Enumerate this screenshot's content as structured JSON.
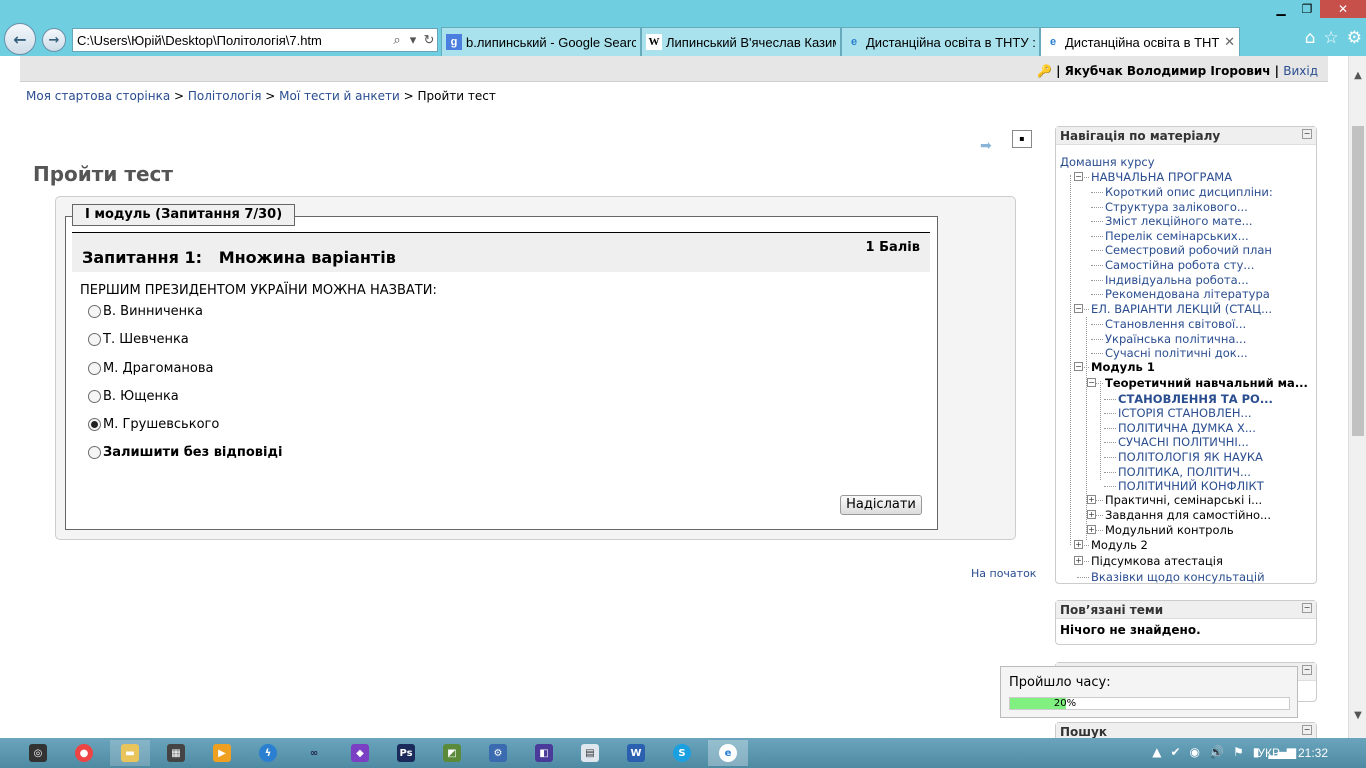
{
  "browser": {
    "address": "C:\\Users\\Юрій\\Desktop\\Політологія\\7.htm",
    "tabs": [
      {
        "label": "b.липинський - Google Search",
        "icon": "google-icon"
      },
      {
        "label": "Липинський В'ячеслав Казим...",
        "icon": "wikipedia-icon"
      },
      {
        "label": "Дистанційна освіта в ТНТУ : ...",
        "icon": "ie-icon"
      },
      {
        "label": "Дистанційна освіта в ТНТУ...",
        "icon": "ie-icon",
        "close": "✕"
      }
    ]
  },
  "user": {
    "name": "Якубчак Володимир Ігорович",
    "sep": "|",
    "logout": "Вихід"
  },
  "breadcrumb": [
    {
      "label": "Моя стартова сторінка"
    },
    {
      "label": "Політологія"
    },
    {
      "label": "Мої тести й анкети"
    },
    {
      "label": "Пройти тест"
    }
  ],
  "page_title": "Пройти тест",
  "quiz": {
    "legend": "I модуль (Запитання 7/30)",
    "question_title": "Запитання 1:   Множина варіантів",
    "marks": "1 Балів",
    "question_text": "ПЕРШИМ ПРЕЗИДЕНТОМ УКРАЇНИ МОЖНА НАЗВАТИ:",
    "options": [
      {
        "label": "В. Винниченка",
        "selected": false
      },
      {
        "label": "Т. Шевченка",
        "selected": false
      },
      {
        "label": "М. Драгоманова",
        "selected": false
      },
      {
        "label": "В. Ющенка",
        "selected": false
      },
      {
        "label": "М. Грушевського",
        "selected": true
      },
      {
        "label": "Залишити без відповіді",
        "selected": false
      }
    ],
    "submit": "Надіслати",
    "to_top": "На початок"
  },
  "nav_block": {
    "title": "Навігація по матеріалу",
    "items": [
      {
        "label": "Домашня курсу"
      },
      {
        "label": "НАВЧАЛЬНА ПРОГРАМА"
      },
      {
        "label": "Короткий опис дисципліни:"
      },
      {
        "label": "Структура залікового..."
      },
      {
        "label": "Зміст лекційного мате..."
      },
      {
        "label": "Перелік семінарських..."
      },
      {
        "label": "Семестровий робочий план"
      },
      {
        "label": "Самостійна робота сту..."
      },
      {
        "label": "Індивідуальна робота..."
      },
      {
        "label": "Рекомендована література"
      },
      {
        "label": "ЕЛ. ВАРІАНТИ ЛЕКЦІЙ (СТАЦ..."
      },
      {
        "label": "Становлення світової..."
      },
      {
        "label": "Українська політична..."
      },
      {
        "label": "Сучасні політичні док..."
      },
      {
        "label": "Модуль 1"
      },
      {
        "label": "Теоретичний навчальний ма..."
      },
      {
        "label": "СТАНОВЛЕННЯ ТА РО..."
      },
      {
        "label": "ІСТОРІЯ СТАНОВЛЕН..."
      },
      {
        "label": "ПОЛІТИЧНА ДУМКА Х..."
      },
      {
        "label": "СУЧАСНІ ПОЛІТИЧНІ..."
      },
      {
        "label": "ПОЛІТОЛОГІЯ ЯК НАУКА"
      },
      {
        "label": "ПОЛІТИКА, ПОЛІТИЧ..."
      },
      {
        "label": "ПОЛІТИЧНИЙ КОНФЛІКТ"
      },
      {
        "label": "Практичні, семінарські і..."
      },
      {
        "label": "Завдання для самостійно..."
      },
      {
        "label": "Модульний контроль"
      },
      {
        "label": "Модуль 2"
      },
      {
        "label": "Підсумкова атестація"
      },
      {
        "label": "Вказівки щодо консультацій"
      }
    ]
  },
  "related_block": {
    "title": "Пов’язані теми",
    "empty": "Нічого не знайдено."
  },
  "search_block": {
    "title": "Пошук"
  },
  "timer": {
    "label": "Пройшло часу:",
    "progress": 0.2,
    "progress_text": "20%"
  },
  "taskbar": {
    "lang": "УКР",
    "time": "21:32"
  }
}
